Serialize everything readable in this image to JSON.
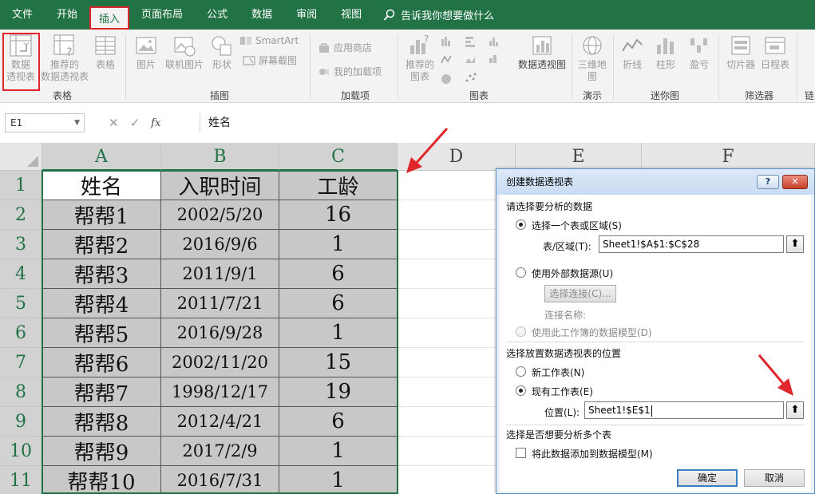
{
  "ribbon_tabs": [
    {
      "label": "文件"
    },
    {
      "label": "开始"
    },
    {
      "label": "插入"
    },
    {
      "label": "页面布局"
    },
    {
      "label": "公式"
    },
    {
      "label": "数据"
    },
    {
      "label": "审阅"
    },
    {
      "label": "视图"
    }
  ],
  "tell_me": "告诉我你想要做什么",
  "ribbon": {
    "pivot_table": "数据\n透视表",
    "recommended_pivot": "推荐的\n数据透视表",
    "table": "表格",
    "group_tables": "表格",
    "picture": "图片",
    "online_picture": "联机图片",
    "shapes": "形状",
    "smartart": "SmartArt",
    "screenshot": "屏幕截图",
    "group_illustrations": "插图",
    "store": "应用商店",
    "my_addins": "我的加载项",
    "group_addins": "加载项",
    "recommended_charts": "推荐的\n图表",
    "pivot_chart": "数据透视图",
    "group_charts": "图表",
    "map_3d": "三维地\n图",
    "group_tours": "演示",
    "line": "折线",
    "column": "柱形",
    "win_loss": "盈亏",
    "group_sparklines": "迷你图",
    "slicer": "切片器",
    "timeline": "日程表",
    "group_filters": "筛选器",
    "group_links": "链"
  },
  "formula_bar": {
    "name_box": "E1",
    "fx": "fx",
    "content": "姓名"
  },
  "columns": [
    "A",
    "B",
    "C",
    "D",
    "E",
    "F"
  ],
  "rows": [
    "1",
    "2",
    "3",
    "4",
    "5",
    "6",
    "7",
    "8",
    "9",
    "10",
    "11"
  ],
  "table": {
    "headers": [
      "姓名",
      "入职时间",
      "工龄"
    ],
    "data": [
      [
        "帮帮1",
        "2002/5/20",
        "16"
      ],
      [
        "帮帮2",
        "2016/9/6",
        "1"
      ],
      [
        "帮帮3",
        "2011/9/1",
        "6"
      ],
      [
        "帮帮4",
        "2011/7/21",
        "6"
      ],
      [
        "帮帮5",
        "2016/9/28",
        "1"
      ],
      [
        "帮帮6",
        "2002/11/20",
        "15"
      ],
      [
        "帮帮7",
        "1998/12/17",
        "19"
      ],
      [
        "帮帮8",
        "2012/4/21",
        "6"
      ],
      [
        "帮帮9",
        "2017/2/9",
        "1"
      ],
      [
        "帮帮10",
        "2016/7/31",
        "1"
      ]
    ]
  },
  "dialog": {
    "title": "创建数据透视表",
    "help": "?",
    "close": "✕",
    "section_source": "请选择要分析的数据",
    "opt_select_range": "选择一个表或区域(S)",
    "range_label": "表/区域(T):",
    "range_value": "Sheet1!$A$1:$C$28",
    "opt_external": "使用外部数据源(U)",
    "choose_connection": "选择连接(C)...",
    "connection_name": "连接名称:",
    "opt_data_model": "使用此工作簿的数据模型(D)",
    "section_location": "选择放置数据透视表的位置",
    "opt_new_sheet": "新工作表(N)",
    "opt_existing_sheet": "现有工作表(E)",
    "location_label": "位置(L):",
    "location_value": "Sheet1!$E$1",
    "section_multi": "选择是否想要分析多个表",
    "add_to_model": "将此数据添加到数据模型(M)",
    "ok": "确定",
    "cancel": "取消"
  },
  "colors": {
    "excel_green": "#217346",
    "highlight_red": "#e0262a",
    "cell_fill": "#c8c8c8"
  }
}
